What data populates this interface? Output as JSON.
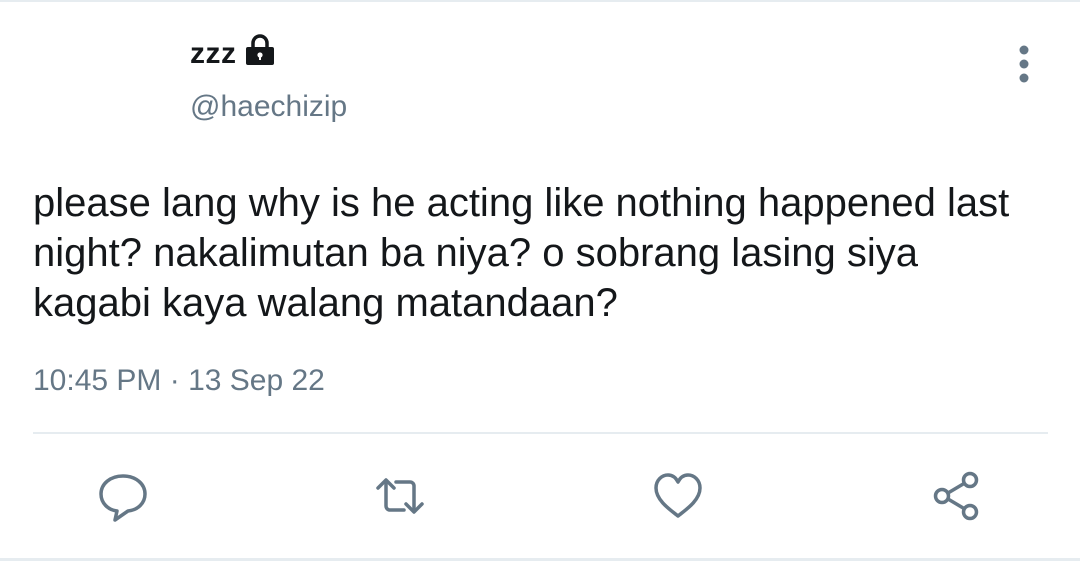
{
  "author": {
    "display_name": "zzz",
    "handle": "@haechizip",
    "protected_icon": "lock-icon"
  },
  "tweet": {
    "text": "please lang why is he acting like nothing happened last night? nakalimutan ba niya? o sobrang lasing siya kagabi kaya walang matandaan?",
    "timestamp": "10:45 PM · 13 Sep 22"
  },
  "menu": {
    "icon": "more-vertical-icon"
  },
  "actions": [
    {
      "name": "reply",
      "icon": "reply-icon"
    },
    {
      "name": "retweet",
      "icon": "retweet-icon"
    },
    {
      "name": "like",
      "icon": "heart-icon"
    },
    {
      "name": "share",
      "icon": "share-icon"
    }
  ],
  "colors": {
    "text_primary": "#14171a",
    "text_secondary": "#657786",
    "icon": "#657786",
    "divider": "#e6ecf0"
  }
}
